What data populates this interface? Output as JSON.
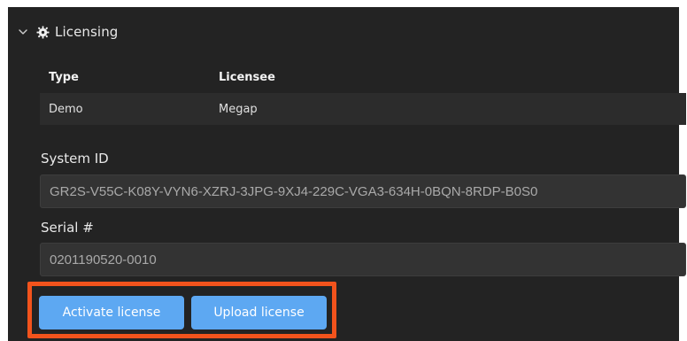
{
  "section": {
    "title": "Licensing",
    "collapse_icon": "chevron-down-icon",
    "section_icon": "gear-icon"
  },
  "table": {
    "headers": {
      "type": "Type",
      "licensee": "Licensee"
    },
    "rows": [
      {
        "type": "Demo",
        "licensee": "Megap"
      }
    ]
  },
  "system_id": {
    "label": "System ID",
    "value": "GR2S-V55C-K08Y-VYN6-XZRJ-3JPG-9XJ4-229C-VGA3-634H-0BQN-8RDP-B0S0"
  },
  "serial": {
    "label": "Serial #",
    "value": "0201190520-0010"
  },
  "actions": {
    "activate_label": "Activate license",
    "upload_label": "Upload license"
  },
  "colors": {
    "panel_bg": "#232323",
    "button_bg": "#5da8f2",
    "highlight": "#f2531c"
  }
}
